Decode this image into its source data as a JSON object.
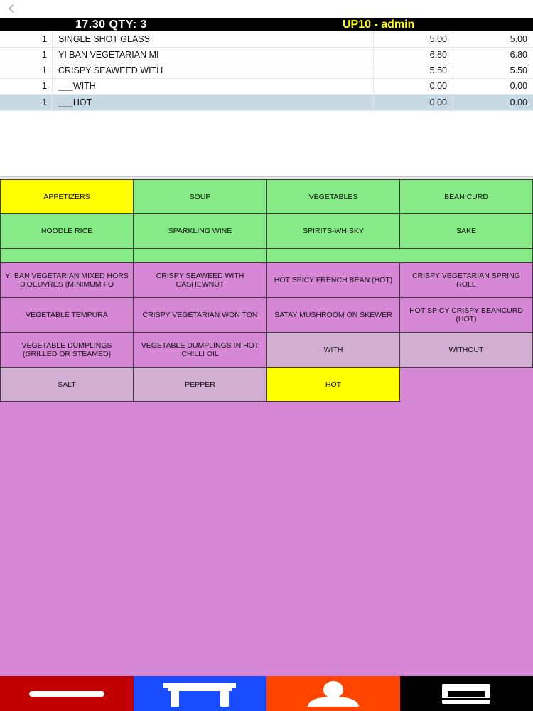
{
  "header": {
    "total_qty": "17.30  QTY: 3",
    "user": "UP10 - admin"
  },
  "orders": [
    {
      "qty": "1",
      "desc": "SINGLE SHOT GLASS",
      "price": "5.00",
      "amount": "5.00"
    },
    {
      "qty": "1",
      "desc": "YI BAN VEGETARIAN MI",
      "price": "6.80",
      "amount": "6.80"
    },
    {
      "qty": "1",
      "desc": "CRISPY SEAWEED WITH",
      "price": "5.50",
      "amount": "5.50"
    },
    {
      "qty": "1",
      "desc": "___WITH",
      "price": "0.00",
      "amount": "0.00"
    },
    {
      "qty": "1",
      "desc": "___HOT",
      "price": "0.00",
      "amount": "0.00"
    }
  ],
  "categories": [
    {
      "label": "APPETIZERS",
      "color": "yellow"
    },
    {
      "label": "SOUP",
      "color": "green"
    },
    {
      "label": "VEGETABLES",
      "color": "green"
    },
    {
      "label": "BEAN CURD",
      "color": "green"
    },
    {
      "label": "NOODLE  RICE",
      "color": "green"
    },
    {
      "label": "SPARKLING WINE",
      "color": "green"
    },
    {
      "label": "SPIRITS-WHISKY",
      "color": "green"
    },
    {
      "label": "SAKE",
      "color": "green"
    }
  ],
  "items": [
    {
      "label": "YI BAN VEGETARIAN MIXED HORS D'OEUVRES (MINIMUM FO",
      "color": "purple"
    },
    {
      "label": "CRISPY SEAWEED WITH CASHEWNUT",
      "color": "purple"
    },
    {
      "label": "HOT  SPICY FRENCH BEAN (HOT)",
      "color": "purple"
    },
    {
      "label": "CRISPY VEGETARIAN SPRING ROLL",
      "color": "purple"
    },
    {
      "label": "VEGETABLE TEMPURA",
      "color": "purple"
    },
    {
      "label": "CRISPY VEGETARIAN WON TON",
      "color": "purple"
    },
    {
      "label": "SATAY MUSHROOM ON SKEWER",
      "color": "purple"
    },
    {
      "label": "HOT  SPICY CRISPY BEANCURD (HOT)",
      "color": "purple"
    },
    {
      "label": "VEGETABLE DUMPLINGS (GRILLED OR STEAMED)",
      "color": "purple"
    },
    {
      "label": "VEGETABLE DUMPLINGS IN HOT CHILLI OIL",
      "color": "purple"
    },
    {
      "label": "WITH",
      "color": "mauve"
    },
    {
      "label": "WITHOUT",
      "color": "mauve"
    },
    {
      "label": "SALT",
      "color": "mauve"
    },
    {
      "label": "PEPPER",
      "color": "mauve"
    },
    {
      "label": "HOT",
      "color": "yellow"
    }
  ],
  "tabbar": {
    "tabs": [
      {
        "name": "minus-tab",
        "icon": "minus-icon",
        "color": "#c00000"
      },
      {
        "name": "table-tab",
        "icon": "table-icon",
        "color": "#1a4dff"
      },
      {
        "name": "customer-tab",
        "icon": "person-icon",
        "color": "#ff4400"
      },
      {
        "name": "cash-drawer-tab",
        "icon": "cash-drawer-icon",
        "color": "#000000"
      }
    ]
  },
  "colors": {
    "green": "#86ea86",
    "yellow": "#ffff00",
    "purple": "#d688d6",
    "mauve": "#d2aed2",
    "selected_row": "#c8d9e6"
  }
}
